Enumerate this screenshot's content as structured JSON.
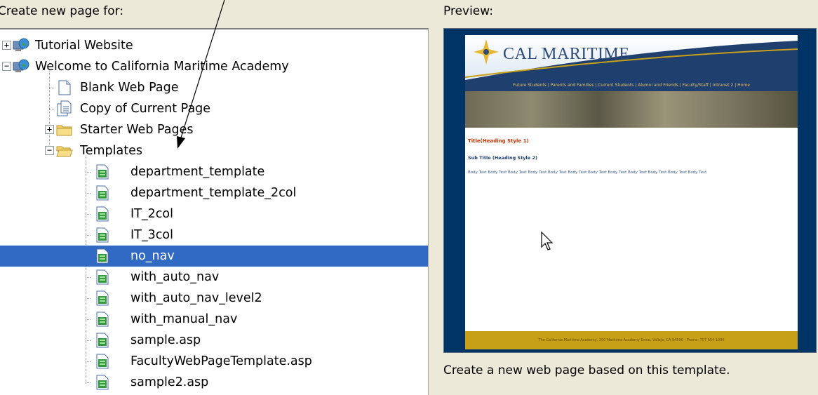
{
  "left_panel": {
    "label": "Create new page for:",
    "tree": [
      {
        "label": "Tutorial Website",
        "icon": "globe-computer-icon",
        "expander": "+"
      },
      {
        "label": "Welcome to California Maritime Academy",
        "icon": "globe-computer-icon",
        "expander": "−"
      },
      {
        "label": "Blank Web Page",
        "icon": "blank-page-icon"
      },
      {
        "label": "Copy of Current Page",
        "icon": "copy-page-icon"
      },
      {
        "label": "Starter Web Pages",
        "icon": "folder-icon",
        "expander": "+"
      },
      {
        "label": "Templates",
        "icon": "folder-open-icon",
        "expander": "−"
      },
      {
        "label": "department_template",
        "icon": "template-icon"
      },
      {
        "label": "department_template_2col",
        "icon": "template-icon"
      },
      {
        "label": "IT_2col",
        "icon": "template-icon"
      },
      {
        "label": "IT_3col",
        "icon": "template-icon"
      },
      {
        "label": "no_nav",
        "icon": "template-icon",
        "selected": true
      },
      {
        "label": "with_auto_nav",
        "icon": "template-icon"
      },
      {
        "label": "with_auto_nav_level2",
        "icon": "template-icon"
      },
      {
        "label": "with_manual_nav",
        "icon": "template-icon"
      },
      {
        "label": "sample.asp",
        "icon": "template-icon"
      },
      {
        "label": "FacultyWebPageTemplate.asp",
        "icon": "template-icon"
      },
      {
        "label": "sample2.asp",
        "icon": "template-icon"
      }
    ]
  },
  "right_panel": {
    "label": "Preview:",
    "caption": "Create a new web page based on this template.",
    "preview": {
      "logo": "CAL MARITIME",
      "nav": "Future Students | Parents and Families | Current Students | Alumni and Friends | Faculty/Staff | Intranet 2 | Home",
      "heading1": "Title(Heading Style 1)",
      "heading2": "Sub Title (Heading Style 2)",
      "body": "Body Text Body Text Body Text Body Text Body Text Body Text Body Text Body Text Body Text Body Text Body Text Body Text",
      "footer": "The California Maritime Academy, 200 Maritime Academy Drive, Vallejo, CA 94590 · Phone: 707 654 1000"
    }
  },
  "colors": {
    "selection": "#316ac5",
    "window_bg": "#ece9d8",
    "preview_border": "#003366",
    "preview_footer": "#c8a017",
    "preview_heading": "#cc3300"
  }
}
